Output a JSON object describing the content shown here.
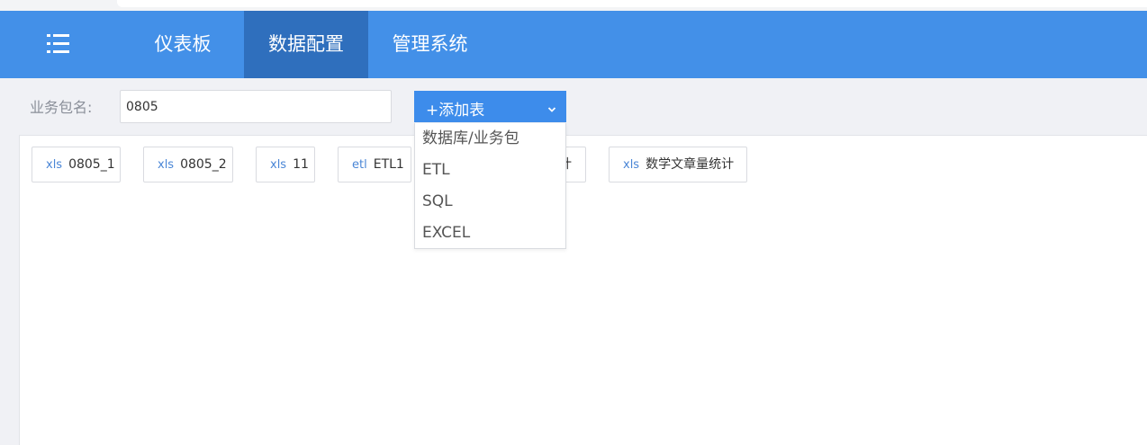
{
  "nav": {
    "items": [
      {
        "label": "仪表板"
      },
      {
        "label": "数据配置",
        "active": true
      },
      {
        "label": "管理系统"
      }
    ],
    "menu_icon": "list-menu-icon",
    "bg_color": "#4390e8",
    "active_bg_color": "#2f6fbd"
  },
  "toolbar": {
    "package_label": "业务包名:",
    "package_value": "0805",
    "add_table_label": "+添加表",
    "add_table_icon": "chevron-down-icon"
  },
  "dropdown": {
    "items": [
      {
        "label": "数据库/业务包"
      },
      {
        "label": "ETL"
      },
      {
        "label": "SQL"
      },
      {
        "label": "EXCEL"
      }
    ]
  },
  "tables": [
    {
      "type": "xls",
      "name": "0805_1"
    },
    {
      "type": "xls",
      "name": "0805_2"
    },
    {
      "type": "xls",
      "name": "11"
    },
    {
      "type": "etl",
      "name": "ETL1"
    },
    {
      "type": "",
      "name": "计"
    },
    {
      "type": "xls",
      "name": "数学文章量统计"
    }
  ]
}
